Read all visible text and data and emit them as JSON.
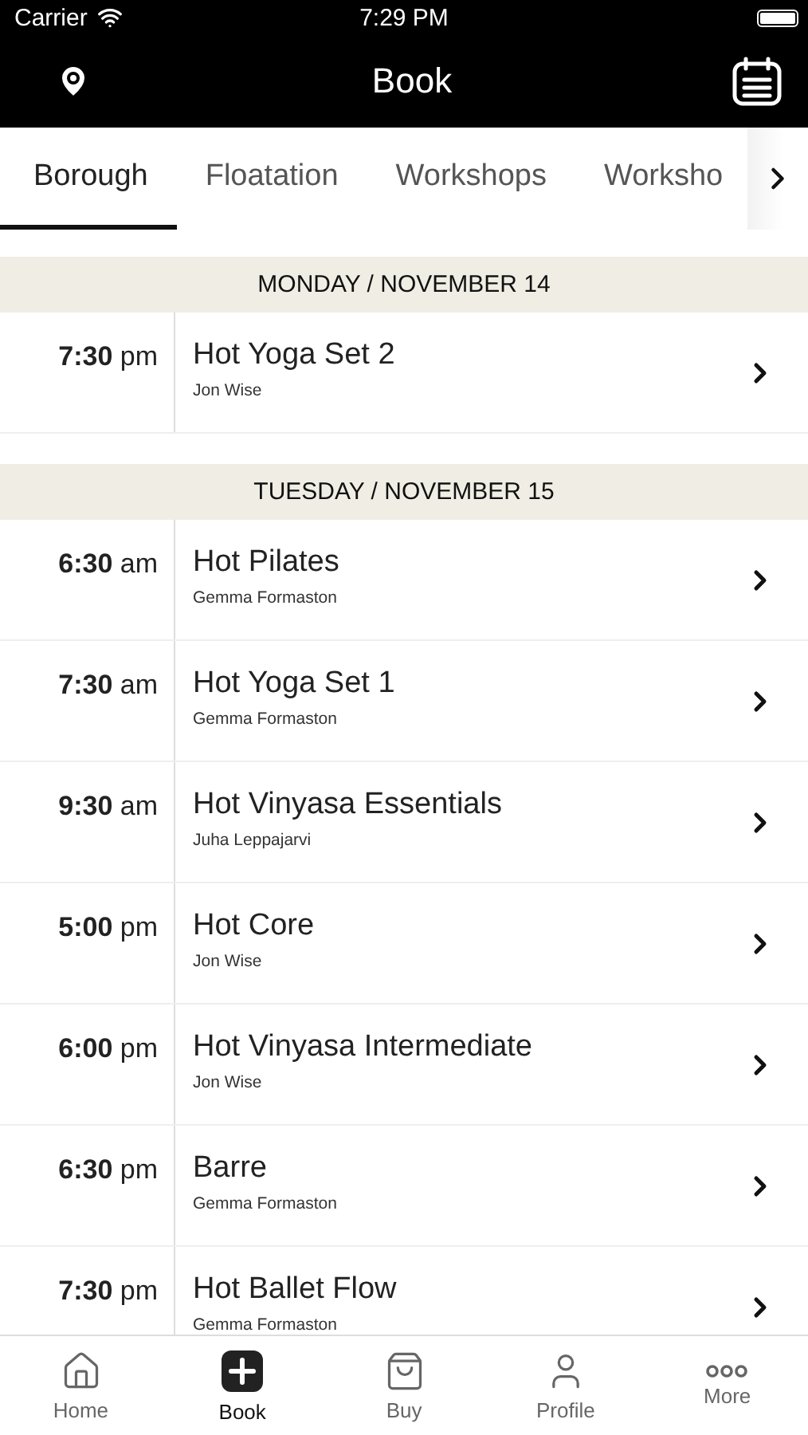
{
  "status_bar": {
    "carrier": "Carrier",
    "time": "7:29 PM"
  },
  "nav": {
    "title": "Book"
  },
  "tabs": [
    {
      "label": "Borough",
      "selected": true
    },
    {
      "label": "Floatation",
      "selected": false
    },
    {
      "label": "Workshops",
      "selected": false
    },
    {
      "label": "Worksho",
      "selected": false
    }
  ],
  "days": [
    {
      "header": "MONDAY / NOVEMBER 14",
      "classes": [
        {
          "time": "**7:30** pm",
          "name": "Hot Yoga Set 2",
          "teacher": "Jon Wise"
        }
      ]
    },
    {
      "header": "TUESDAY / NOVEMBER 15",
      "classes": [
        {
          "time": "**6:30** am",
          "name": "Hot Pilates",
          "teacher": "Gemma Formaston"
        },
        {
          "time": "**7:30** am",
          "name": "Hot Yoga Set 1",
          "teacher": "Gemma Formaston"
        },
        {
          "time": "**9:30** am",
          "name": "Hot Vinyasa Essentials",
          "teacher": "Juha Leppajarvi"
        },
        {
          "time": "**5:00** pm",
          "name": "Hot Core",
          "teacher": "Jon Wise"
        },
        {
          "time": "**6:00** pm",
          "name": "Hot Vinyasa Intermediate",
          "teacher": "Jon Wise"
        },
        {
          "time": "**6:30** pm",
          "name": "Barre",
          "teacher": "Gemma Formaston"
        },
        {
          "time": "**7:30** pm",
          "name": "Hot Ballet Flow",
          "teacher": "Gemma Formaston"
        }
      ]
    }
  ],
  "tab_bar": [
    {
      "kind": "home",
      "label": "Home",
      "selected": false
    },
    {
      "kind": "book",
      "label": "Book",
      "selected": true
    },
    {
      "kind": "buy",
      "label": "Buy",
      "selected": false
    },
    {
      "kind": "profile",
      "label": "Profile",
      "selected": false
    },
    {
      "kind": "more",
      "label": "More",
      "selected": false
    }
  ]
}
